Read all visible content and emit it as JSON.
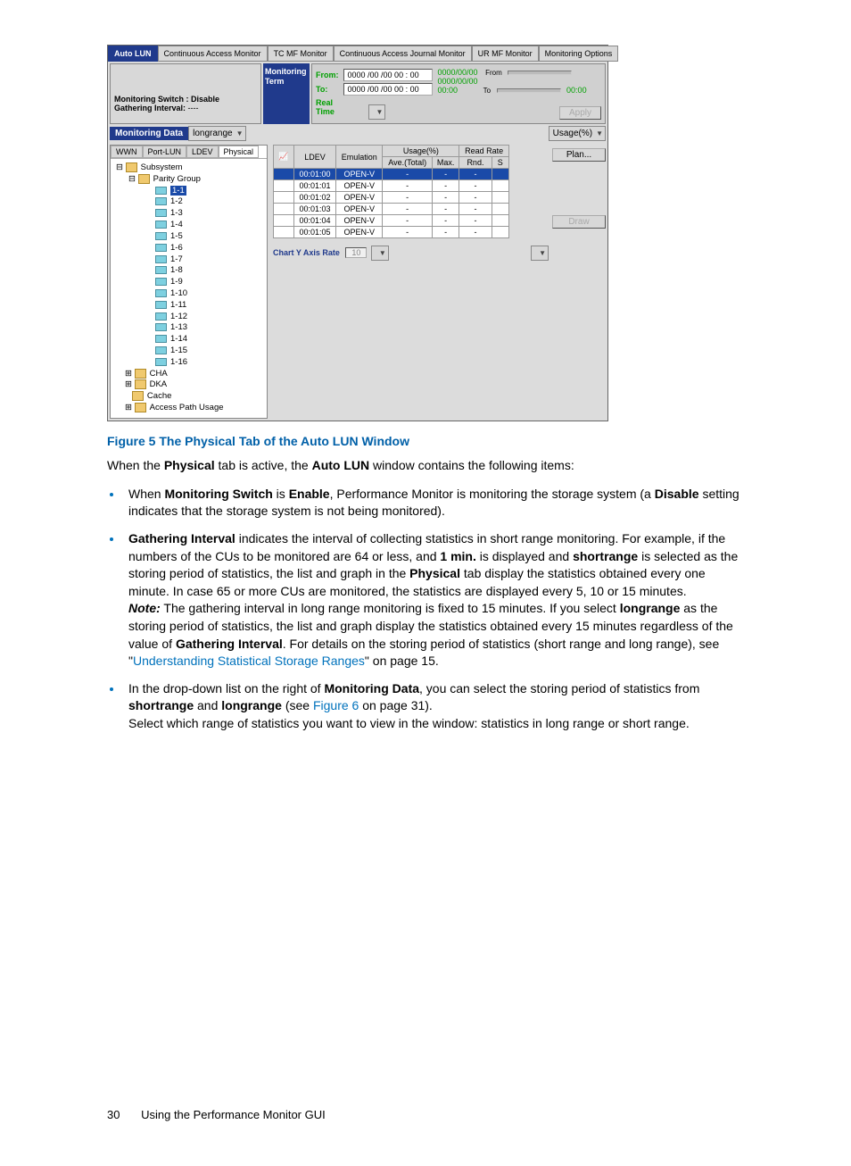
{
  "screenshot": {
    "tabs": [
      "Auto LUN",
      "Continuous Access Monitor",
      "TC MF Monitor",
      "Continuous Access Journal Monitor",
      "UR MF Monitor",
      "Monitoring Options"
    ],
    "left_info": {
      "switch_label": "Monitoring Switch :",
      "switch_value": "Disable",
      "interval_label": "Gathering Interval:",
      "interval_value": "----"
    },
    "term": {
      "l1": "Monitoring",
      "l2": "Term"
    },
    "time": {
      "from_label": "From:",
      "to_label": "To:",
      "from_val": "0000 /00 /00  00 : 00",
      "to_val": "0000 /00 /00  00 : 00",
      "realtime": "Real Time",
      "slider_from": "From",
      "slider_to": "To",
      "hint_date": "0000/00/00",
      "hint_time": "00:00",
      "apply": "Apply"
    },
    "monitoring_data_label": "Monitoring Data",
    "monitoring_data_value": "longrange",
    "usage_combo_label": "Usage(%)",
    "tree_tabs": [
      "WWN",
      "Port-LUN",
      "LDEV",
      "Physical"
    ],
    "tree": {
      "root": "Subsystem",
      "pg": "Parity Group",
      "leaves": [
        "1-1",
        "1-2",
        "1-3",
        "1-4",
        "1-5",
        "1-6",
        "1-7",
        "1-8",
        "1-9",
        "1-10",
        "1-11",
        "1-12",
        "1-13",
        "1-14",
        "1-15",
        "1-16"
      ],
      "cha": "CHA",
      "dka": "DKA",
      "cache": "Cache",
      "apu": "Access Path Usage"
    },
    "table": {
      "h_ldev": "LDEV",
      "h_emu": "Emulation",
      "h_usage": "Usage(%)",
      "h_ave": "Ave.(Total)",
      "h_max": "Max.",
      "h_rr": "Read Rate",
      "h_rnd": "Rnd.",
      "h_s": "S",
      "rows": [
        {
          "ldev": "00:01:00",
          "emu": "OPEN-V",
          "a": "-",
          "m": "-",
          "r": "-"
        },
        {
          "ldev": "00:01:01",
          "emu": "OPEN-V",
          "a": "-",
          "m": "-",
          "r": "-"
        },
        {
          "ldev": "00:01:02",
          "emu": "OPEN-V",
          "a": "-",
          "m": "-",
          "r": "-"
        },
        {
          "ldev": "00:01:03",
          "emu": "OPEN-V",
          "a": "-",
          "m": "-",
          "r": "-"
        },
        {
          "ldev": "00:01:04",
          "emu": "OPEN-V",
          "a": "-",
          "m": "-",
          "r": "-"
        },
        {
          "ldev": "00:01:05",
          "emu": "OPEN-V",
          "a": "-",
          "m": "-",
          "r": "-"
        }
      ]
    },
    "plan_btn": "Plan...",
    "draw_btn": "Draw",
    "chart_y_label": "Chart Y Axis Rate",
    "chart_y_val": "10"
  },
  "caption": "Figure 5 The Physical Tab of the Auto LUN Window",
  "intro_1": "When the ",
  "intro_b1": "Physical",
  "intro_2": " tab is active, the ",
  "intro_b2": "Auto LUN",
  "intro_3": " window contains the following items:",
  "li1": {
    "t1": "When ",
    "b1": "Monitoring Switch",
    "t2": " is ",
    "b2": "Enable",
    "t3": ", Performance Monitor is monitoring the storage system (a ",
    "b3": "Disable",
    "t4": " setting indicates that the storage system is not being monitored)."
  },
  "li2": {
    "b1": "Gathering Interval",
    "t1": " indicates the interval of collecting statistics in short range monitoring. For example, if the numbers of the CUs to be monitored are 64 or less, and ",
    "b2": "1 min.",
    "t2": " is displayed and ",
    "b3": "shortrange",
    "t3": " is selected as the storing period of statistics, the list and graph in the ",
    "b4": "Physical",
    "t4": " tab display the statistics obtained every one minute. In case 65 or more CUs are monitored, the statistics are displayed every 5, 10 or 15 minutes.",
    "note_b": "Note:",
    "note_1": " The gathering interval in long range monitoring is fixed to 15 minutes. If you select ",
    "note_b2": "longrange",
    "note_2": " as the storing period of statistics, the list and graph display the statistics obtained every 15 minutes regardless of the value of ",
    "note_b3": "Gathering Interval",
    "note_3": ". For details on the storing period of statistics (short range and long range), see \"",
    "link": "Understanding Statistical Storage Ranges",
    "note_4": "\" on page 15."
  },
  "li3": {
    "t1": "In the drop-down list on the right of ",
    "b1": "Monitoring Data",
    "t2": ", you can select the storing period of statistics from ",
    "b2": "shortrange",
    "t3": " and ",
    "b3": "longrange",
    "t4": " (see ",
    "link": "Figure 6",
    "t5": " on page 31).",
    "t6": "Select which range of statistics you want to view in the window: statistics in long range or short range."
  },
  "footer": {
    "page": "30",
    "title": "Using the Performance Monitor GUI"
  }
}
